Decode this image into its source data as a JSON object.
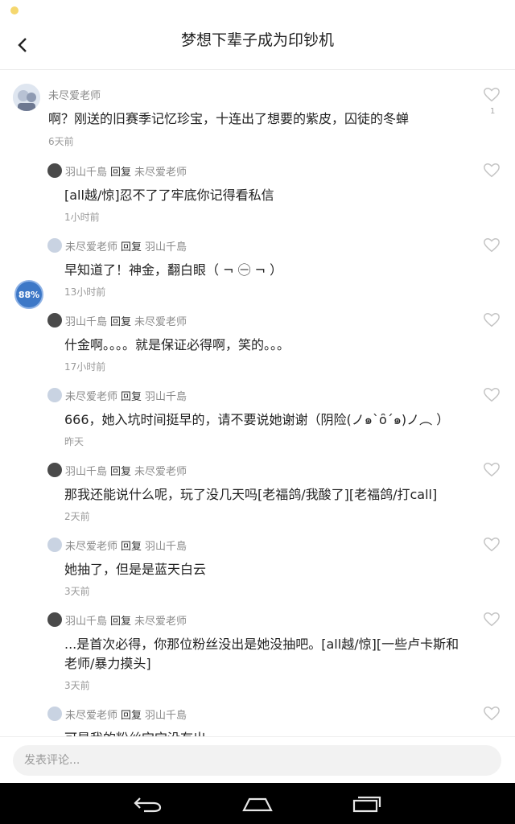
{
  "header": {
    "title": "梦想下辈子成为印钞机",
    "back_icon": "chevron-left-icon"
  },
  "main_comment": {
    "author": "未尽爱老师",
    "text": "啊？刚送的旧赛季记忆珍宝，十连出了想要的紫皮，囚徒的冬蝉",
    "time": "6天前",
    "likes": "1"
  },
  "reply_word": "回复",
  "replies": [
    {
      "author": "羽山千島",
      "target": "未尽爱老师",
      "text": "[all越/惊]忍不了了牢底你记得看私信",
      "time": "1小时前"
    },
    {
      "author": "未尽爱老师",
      "target": "羽山千島",
      "text": "早知道了！神金，翻白眼（ ¬ ㊀ ¬ ）",
      "time": "13小时前"
    },
    {
      "author": "羽山千島",
      "target": "未尽爱老师",
      "text": "什金啊。。。。就是保证必得啊，笑的。。。",
      "time": "17小时前"
    },
    {
      "author": "未尽爱老师",
      "target": "羽山千島",
      "text": "666，她入坑时间挺早的，请不要说她谢谢（阴险(ノ๑`ȏ´๑)ノ︵ ）",
      "time": "昨天"
    },
    {
      "author": "羽山千島",
      "target": "未尽爱老师",
      "text": "那我还能说什么呢，玩了没几天吗[老福鸽/我酸了][老福鸽/打call]",
      "time": "2天前"
    },
    {
      "author": "未尽爱老师",
      "target": "羽山千島",
      "text": "她抽了，但是是蓝天白云",
      "time": "3天前"
    },
    {
      "author": "羽山千島",
      "target": "未尽爱老师",
      "text_line1": "...是首次必得，你那位粉丝没出是她没抽吧。[all越/惊][一些卢卡斯和",
      "text_line2": "老师/暴力摸头]",
      "time": "3天前"
    },
    {
      "author": "未尽爱老师",
      "target": "羽山千島",
      "text": "可是我的粉丝宝宝没有出"
    }
  ],
  "progress_badge": "88%",
  "compose": {
    "placeholder": "发表评论..."
  },
  "navbar": {
    "back": "back-icon",
    "home": "home-icon",
    "recents": "recents-icon"
  },
  "colors": {
    "accent_badge": "#3d78c7",
    "status_dot": "#f5d76e",
    "navbar": "#000000"
  }
}
